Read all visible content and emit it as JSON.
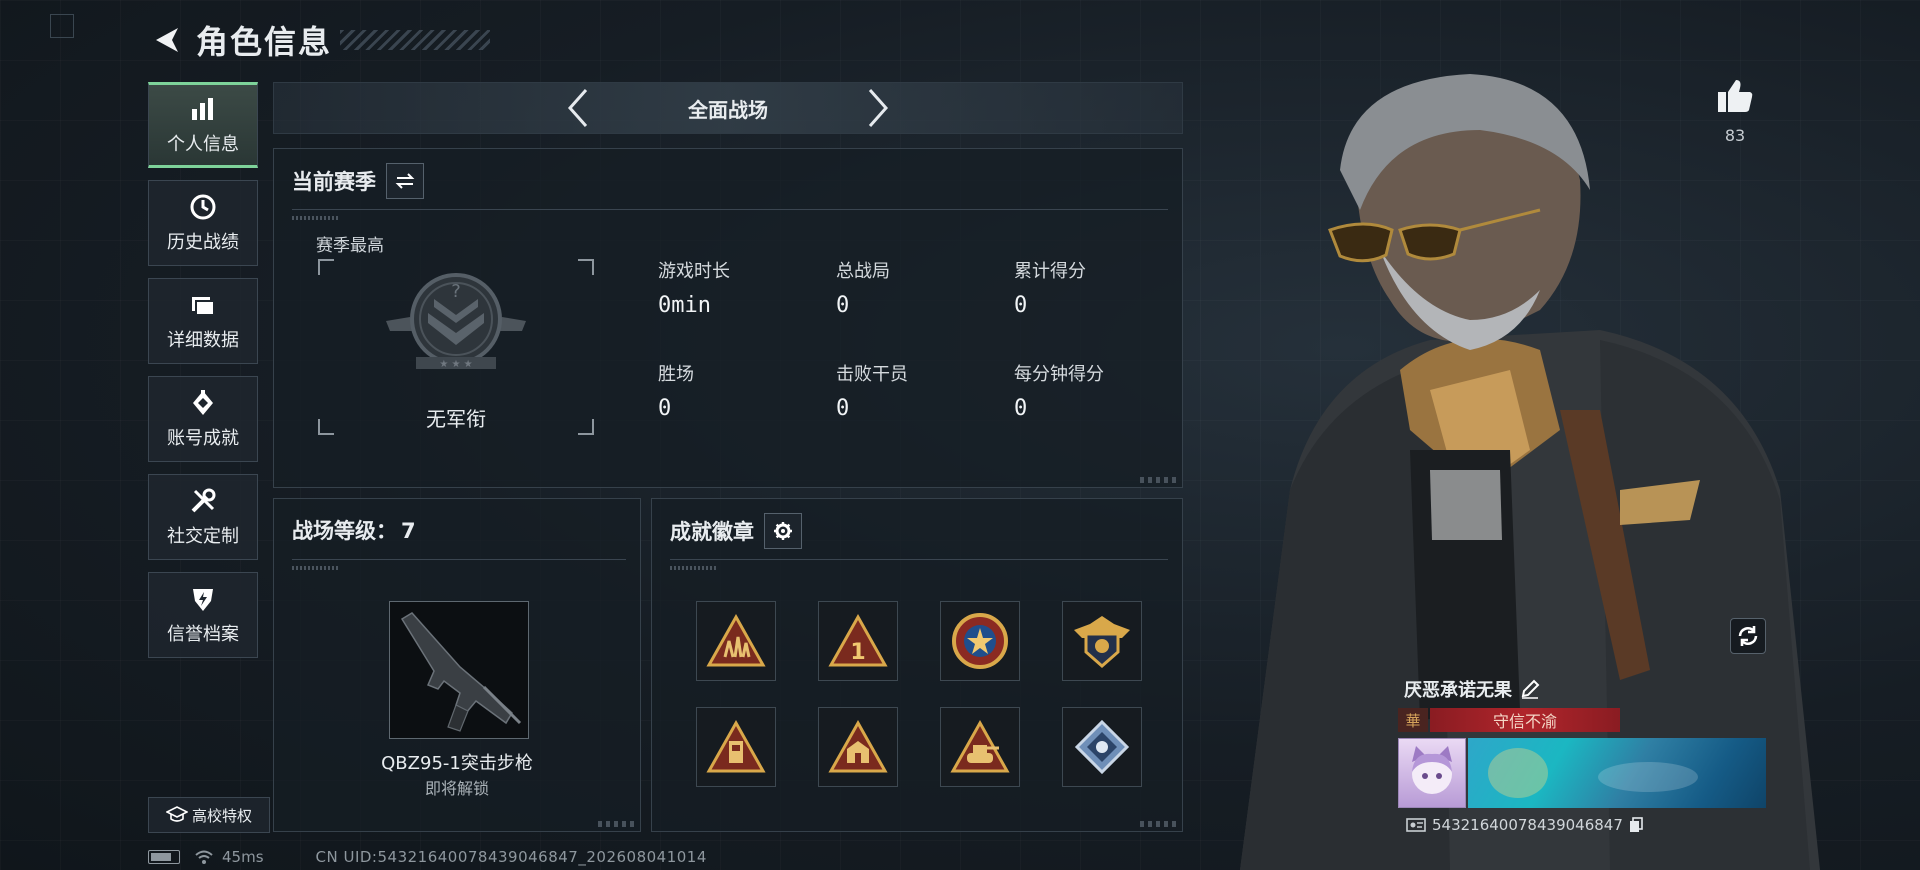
{
  "header": {
    "title": "角色信息"
  },
  "sidebar": {
    "items": [
      {
        "label": "个人信息",
        "icon": "bar-chart-icon",
        "active": true
      },
      {
        "label": "历史战绩",
        "icon": "clock-history-icon",
        "active": false
      },
      {
        "label": "详细数据",
        "icon": "folders-icon",
        "active": false
      },
      {
        "label": "账号成就",
        "icon": "achievement-diamond-icon",
        "active": false
      },
      {
        "label": "社交定制",
        "icon": "tools-icon",
        "active": false
      },
      {
        "label": "信誉档案",
        "icon": "shield-bolt-icon",
        "active": false
      }
    ],
    "campus_label": "高校特权"
  },
  "mode_nav": {
    "current": "全面战场"
  },
  "season": {
    "title": "当前赛季",
    "sub_title": "赛季最高",
    "rank_name": "无军衔",
    "stats": [
      {
        "label": "游戏时长",
        "value": "0min"
      },
      {
        "label": "总战局",
        "value": "0"
      },
      {
        "label": "累计得分",
        "value": "0"
      },
      {
        "label": "胜场",
        "value": "0"
      },
      {
        "label": "击败干员",
        "value": "0"
      },
      {
        "label": "每分钟得分",
        "value": "0"
      }
    ]
  },
  "level": {
    "title": "战场等级：",
    "value": "7",
    "weapon_name": "QBZ95-1突击步枪",
    "weapon_state": "即将解锁"
  },
  "badges": {
    "title": "成就徽章",
    "items": [
      "badge-soldiers-triangle-icon",
      "badge-number-one-triangle-icon",
      "badge-star-medal-icon",
      "badge-eagle-shield-icon",
      "badge-tower-triangle-icon",
      "badge-building-triangle-icon",
      "badge-tank-triangle-icon",
      "badge-blue-diamond-icon"
    ]
  },
  "status_bar": {
    "ping": "45ms",
    "uid": "CN UID:54321640078439046847_202608041014"
  },
  "character": {
    "like_count": "83",
    "nickname": "厌恶承诺无果",
    "title_badge": "守信不渝",
    "title_emblem": "華",
    "uid": "54321640078439046847"
  },
  "colors": {
    "accent_green": "#7ed39a",
    "title_red": "#b0252b",
    "badge_gold": "#c99a3e"
  }
}
